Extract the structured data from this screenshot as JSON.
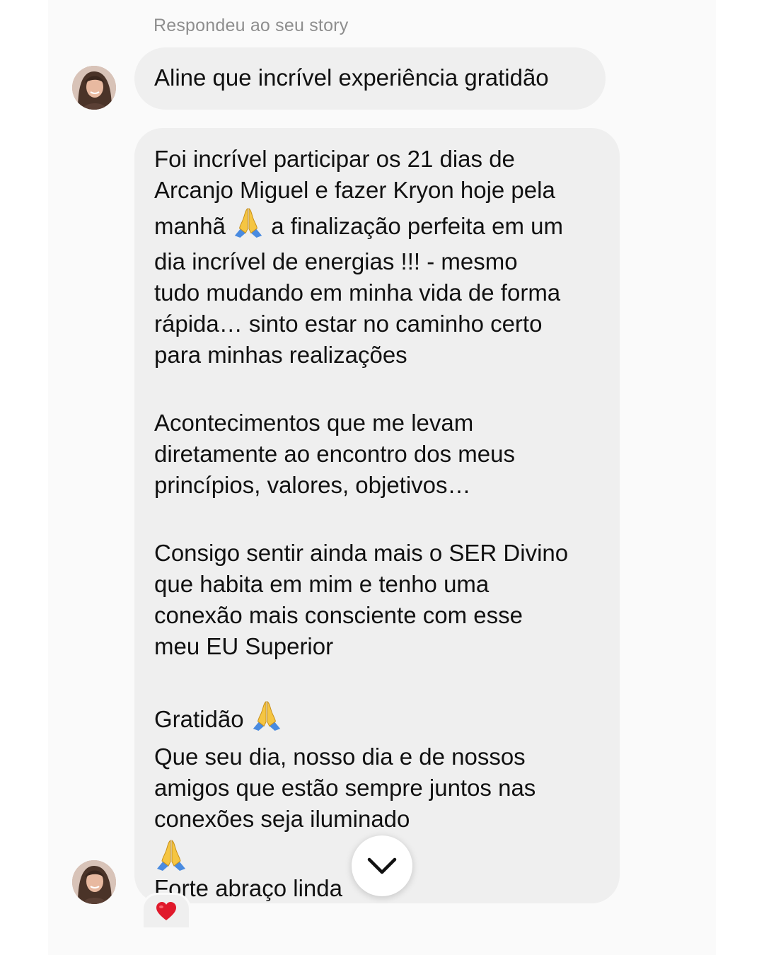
{
  "header": {
    "story_reply_label": "Respondeu ao seu story"
  },
  "messages": {
    "first": {
      "text": "Aline que incrível experiência  gratidão"
    },
    "second": {
      "p1": [
        "Foi incrível participar os 21 dias de",
        "Arcanjo Miguel e  fazer Kryon hoje pela",
        "manhã",
        "a finalização perfeita em um",
        "dia incrível de energias !!!  - mesmo",
        "tudo mudando em minha vida de forma",
        "rápida… sinto estar no caminho certo",
        "para minhas realizações"
      ],
      "p2": [
        "Acontecimentos que me levam",
        "diretamente ao encontro dos meus",
        "princípios, valores, objetivos…"
      ],
      "p3": [
        "Consigo sentir ainda mais o SER Divino",
        "que habita em mim e tenho uma",
        "conexão mais consciente com esse",
        "meu EU Superior"
      ],
      "p4": [
        "Gratidão",
        "Que seu dia, nosso dia e de nossos",
        "amigos que estão sempre juntos nas",
        "conexões seja iluminado"
      ],
      "closing": "Forte abraço linda"
    }
  },
  "icons": {
    "pray": "folded-hands-emoji",
    "scroll": "chevron-down-icon",
    "reaction": "red-heart-emoji"
  },
  "colors": {
    "bubble": "#efefef",
    "label": "#8e8e8e",
    "heart": "#e0192b",
    "pray_emoji": "#f5c542"
  }
}
